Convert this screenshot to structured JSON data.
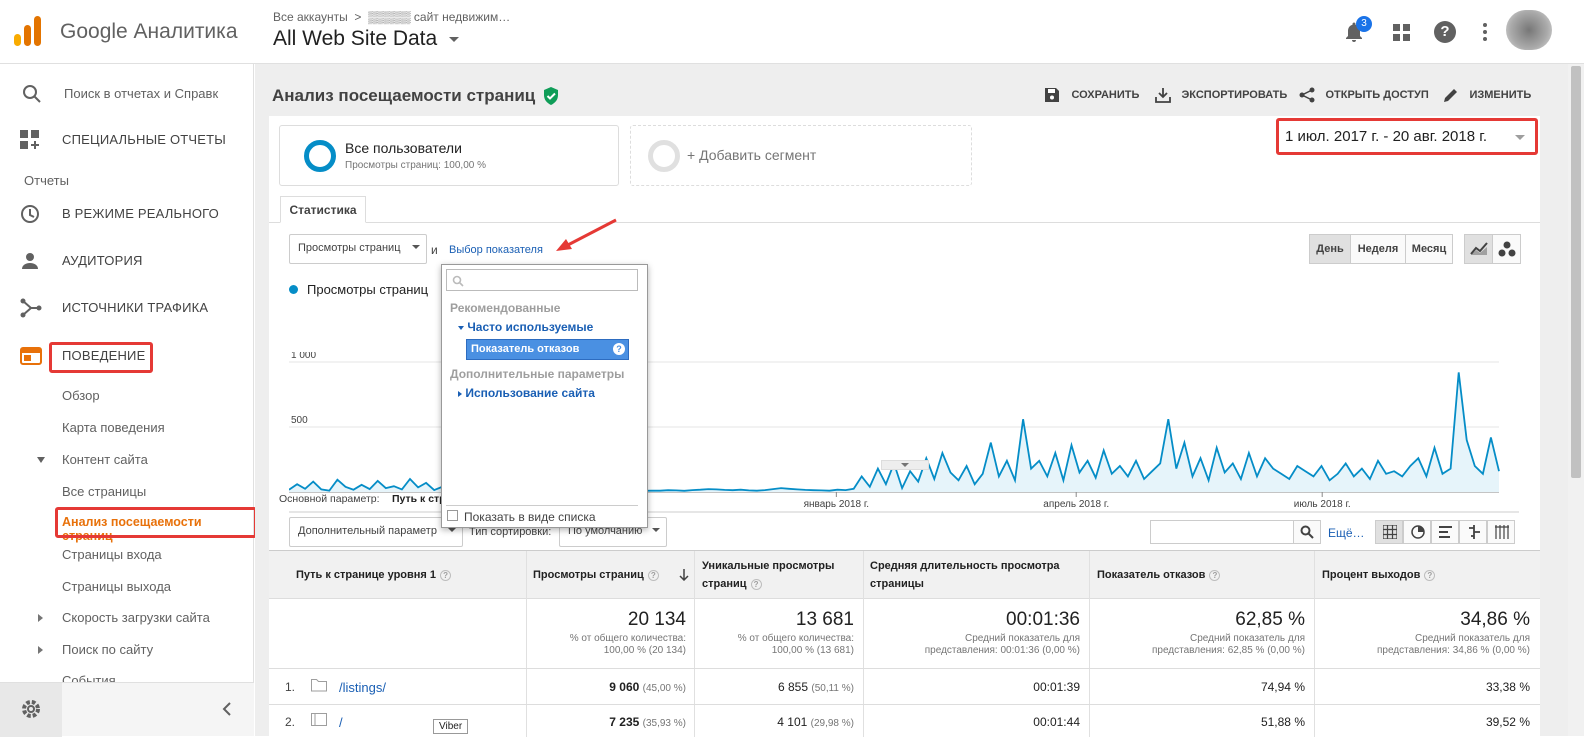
{
  "app": {
    "brand": "Google Аналитика",
    "breadcrumb": "Все аккаунты  >  ▒▒▒▒▒ сайт недвижим…",
    "view": "All Web Site Data",
    "notif_count": "3"
  },
  "sidebar": {
    "search_placeholder": "Поиск в отчетах и Справк",
    "custom_reports": "СПЕЦИАЛЬНЫЕ ОТЧЕТЫ",
    "reports_heading": "Отчеты",
    "realtime": "В РЕЖИМЕ РЕАЛЬНОГО",
    "audience": "АУДИТОРИЯ",
    "acquisition": "ИСТОЧНИКИ ТРАФИКА",
    "behavior": "ПОВЕДЕНИЕ",
    "overview": "Обзор",
    "behavior_flow": "Карта поведения",
    "site_content": "Контент сайта",
    "all_pages": "Все страницы",
    "content_drilldown": "Анализ посещаемости страниц",
    "landing_pages": "Страницы входа",
    "exit_pages": "Страницы выхода",
    "site_speed": "Скорость загрузки сайта",
    "site_search": "Поиск по сайту",
    "events": "События"
  },
  "report": {
    "title": "Анализ посещаемости страниц",
    "save": "СОХРАНИТЬ",
    "export": "ЭКСПОРТИРОВАТЬ",
    "share": "ОТКРЫТЬ ДОСТУП",
    "edit": "ИЗМЕНИТЬ",
    "date_range": "1 июл. 2017 г. - 20 авг. 2018 г.",
    "segment_name": "Все пользователи",
    "segment_sub": "Просмотры страниц: 100,00 %",
    "add_segment": "+ Добавить сегмент",
    "tab_stats": "Статистика",
    "metric_select": "Просмотры страниц",
    "and": "и",
    "choose_metric": "Выбор показателя",
    "day": "День",
    "week": "Неделя",
    "month": "Месяц",
    "legend": "Просмотры страниц",
    "primary_dim_label": "Основной параметр:",
    "primary_dim_value": "Путь к стр",
    "secondary_dim": "Дополнительный параметр",
    "sort_type": "Тип сортировки:",
    "sort_default": "По умолчанию",
    "more": "Ещё…"
  },
  "dropdown": {
    "recommended": "Рекомендованные",
    "frequent": "Часто используемые",
    "selected_item": "Показатель отказов",
    "additional": "Дополнительные параметры",
    "site_usage": "Использование сайта",
    "show_as_list": "Показать в виде списка"
  },
  "chart_data": {
    "type": "area",
    "ylabel_ticks": [
      "1 000",
      "500"
    ],
    "x_tick_labels": [
      "январь 2018 г.",
      "апрель 2018 г.",
      "июль 2018 г."
    ],
    "ylim": [
      0,
      1000
    ],
    "series": [
      {
        "name": "Просмотры страниц",
        "color": "#058dc7",
        "values": [
          18,
          60,
          25,
          80,
          20,
          10,
          95,
          40,
          18,
          55,
          22,
          85,
          30,
          45,
          20,
          100,
          35,
          70,
          15,
          40,
          8,
          5,
          12,
          6,
          10,
          4,
          9,
          5,
          8,
          6,
          5,
          4,
          7,
          5,
          6,
          4,
          8,
          6,
          5,
          7,
          9,
          10,
          12,
          8,
          9,
          11,
          10,
          14,
          12,
          9,
          15,
          18,
          22,
          20,
          16,
          14,
          18,
          12,
          10,
          15,
          22,
          30,
          25,
          20,
          16,
          14,
          12,
          10,
          18,
          15,
          25,
          120,
          40,
          180,
          60,
          220,
          30,
          160,
          80,
          260,
          100,
          300,
          150,
          90,
          200,
          60,
          140,
          380,
          120,
          240,
          90,
          560,
          180,
          240,
          120,
          300,
          90,
          360,
          150,
          240,
          110,
          320,
          140,
          200,
          120,
          240,
          100,
          160,
          220,
          560,
          180,
          380,
          120,
          260,
          90,
          340,
          150,
          220,
          100,
          300,
          120,
          260,
          180,
          140,
          100,
          200,
          160,
          120,
          200,
          90,
          140,
          220,
          120,
          180,
          100,
          240,
          140,
          160,
          120,
          200,
          260,
          120,
          340,
          140,
          180,
          920,
          400,
          200,
          140,
          420,
          160
        ]
      }
    ]
  },
  "table": {
    "headers": [
      "Путь к странице уровня 1",
      "Просмотры страниц",
      "Уникальные просмотры страниц",
      "Средняя длительность просмотра страницы",
      "Показатель отказов",
      "Процент выходов"
    ],
    "totals": [
      {
        "value": "20 134",
        "sub1": "% от общего количества:",
        "sub2": "100,00 % (20 134)"
      },
      {
        "value": "13 681",
        "sub1": "% от общего количества:",
        "sub2": "100,00 % (13 681)"
      },
      {
        "value": "00:01:36",
        "sub1": "Средний показатель для",
        "sub2": "представления: 00:01:36 (0,00 %)"
      },
      {
        "value": "62,85 %",
        "sub1": "Средний показатель для",
        "sub2": "представления: 62,85 % (0,00 %)"
      },
      {
        "value": "34,86 %",
        "sub1": "Средний показатель для",
        "sub2": "представления: 34,86 % (0,00 %)"
      }
    ],
    "rows": [
      {
        "num": "1.",
        "path": "/listings/",
        "pv": "9 060",
        "pv_pct": "(45,00 %)",
        "upv": "6 855",
        "upv_pct": "(50,11 %)",
        "time": "00:01:39",
        "bounce": "74,94 %",
        "exit": "33,38 %"
      },
      {
        "num": "2.",
        "path": "/",
        "pv": "7 235",
        "pv_pct": "(35,93 %)",
        "upv": "4 101",
        "upv_pct": "(29,98 %)",
        "time": "00:01:44",
        "bounce": "51,88 %",
        "exit": "39,52 %"
      }
    ],
    "tooltip": "Viber"
  }
}
